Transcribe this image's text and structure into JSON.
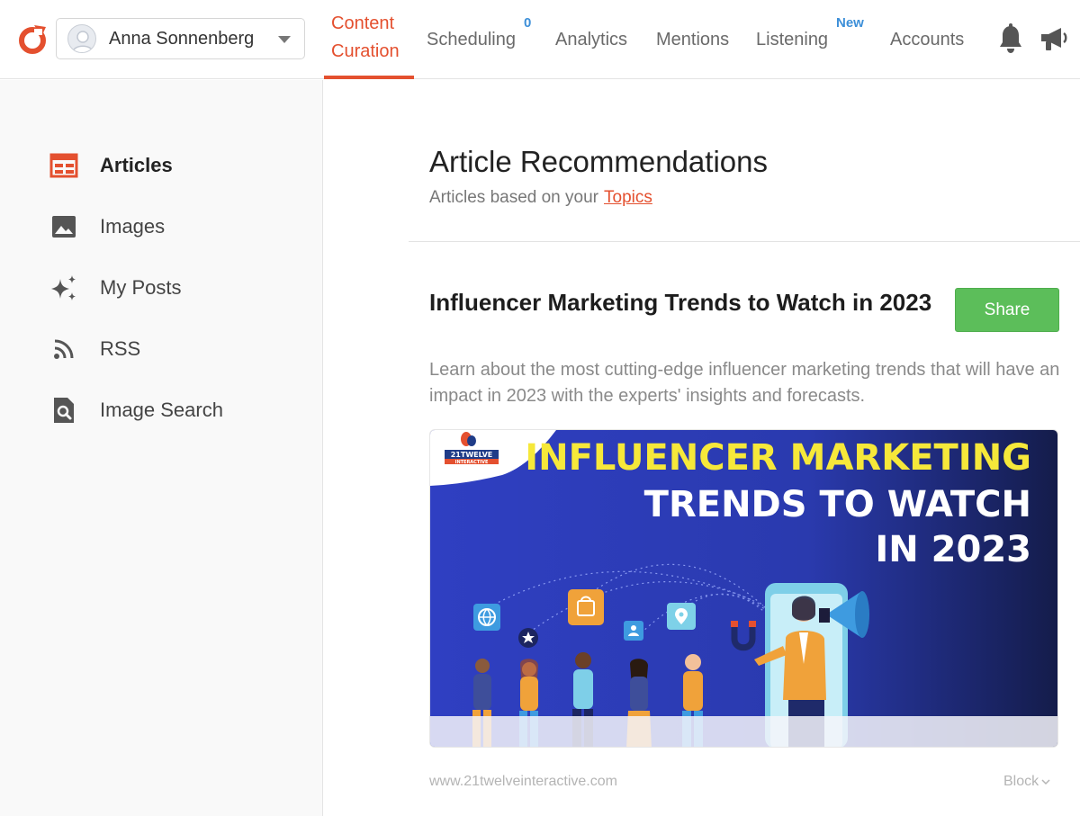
{
  "header": {
    "account_name": "Anna Sonnenberg",
    "nav": [
      {
        "line1": "Content",
        "line2": "Curation"
      },
      {
        "label": "Scheduling",
        "badge": "0"
      },
      {
        "label": "Analytics"
      },
      {
        "label": "Mentions"
      },
      {
        "label": "Listening",
        "badge": "New"
      },
      {
        "label": "Accounts"
      }
    ]
  },
  "sidebar": {
    "items": [
      {
        "label": "Articles",
        "icon": "articles-icon"
      },
      {
        "label": "Images",
        "icon": "image-icon"
      },
      {
        "label": "My Posts",
        "icon": "sparkle-icon"
      },
      {
        "label": "RSS",
        "icon": "rss-icon"
      },
      {
        "label": "Image Search",
        "icon": "image-search-icon"
      }
    ]
  },
  "main": {
    "title": "Article Recommendations",
    "subtitle_prefix": "Articles based on your",
    "subtitle_link": "Topics",
    "article": {
      "title": "Influencer Marketing Trends to Watch in 2023",
      "share_label": "Share",
      "description": "Learn about the most cutting-edge influencer marketing trends that will have an impact in 2023 with the experts' insights and forecasts.",
      "image": {
        "brand": "21TWELVE",
        "brand_sub": "INTERACTIVE",
        "line1": "INFLUENCER MARKETING",
        "line2": "TRENDS TO WATCH",
        "line3": "IN 2023"
      },
      "source": "www.21twelveinteractive.com",
      "block_label": "Block"
    }
  },
  "colors": {
    "accent": "#e4502f",
    "badge": "#3d8fd8",
    "share": "#5cbe5a",
    "image_bg": "#2c3db8",
    "image_yellow": "#f6e83a"
  }
}
